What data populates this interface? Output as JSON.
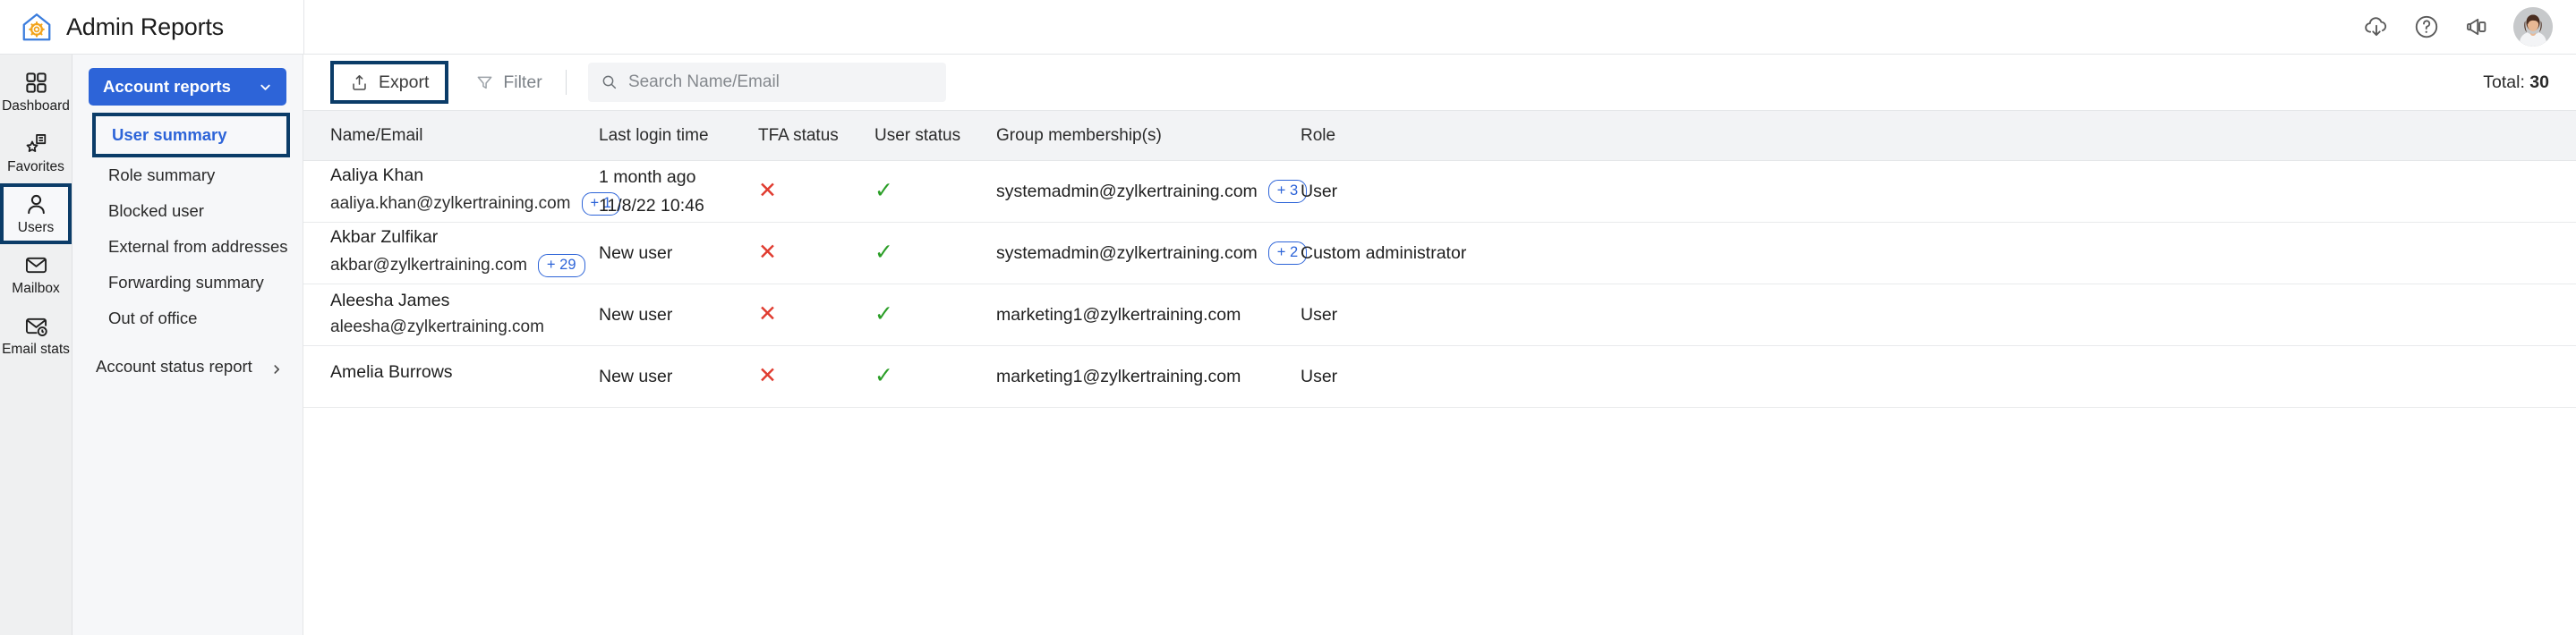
{
  "app": {
    "brand_title": "Admin Reports",
    "logo_icon": "house-gear-icon"
  },
  "topbar": {
    "actions": [
      {
        "icon": "cloud-download-icon",
        "name": "download-button"
      },
      {
        "icon": "help-circle-icon",
        "name": "help-button"
      },
      {
        "icon": "megaphone-icon",
        "name": "announcements-button"
      }
    ],
    "avatar": {
      "icon": "avatar",
      "name": "user-avatar"
    }
  },
  "rail": {
    "items": [
      {
        "label": "Dashboard",
        "icon": "grid-icon",
        "active": false
      },
      {
        "label": "Favorites",
        "icon": "star-list-icon",
        "active": false
      },
      {
        "label": "Users",
        "icon": "user-icon",
        "active": true
      },
      {
        "label": "Mailbox",
        "icon": "envelope-icon",
        "active": false
      },
      {
        "label": "Email stats",
        "icon": "envelope-clock-icon",
        "active": false
      }
    ]
  },
  "subnav": {
    "account_reports_label": "Account reports",
    "account_reports_chevron": "chevron-down-icon",
    "items": [
      {
        "label": "User summary",
        "selected": true
      },
      {
        "label": "Role summary",
        "selected": false
      },
      {
        "label": "Blocked user",
        "selected": false
      },
      {
        "label": "External from addresses",
        "selected": false
      },
      {
        "label": "Forwarding summary",
        "selected": false
      },
      {
        "label": "Out of office",
        "selected": false
      }
    ],
    "footer": {
      "label": "Account status report",
      "chevron": "chevron-right-icon"
    }
  },
  "page": {
    "title": "User summary",
    "star_icon": "star-outline-icon"
  },
  "toolbar": {
    "export_label": "Export",
    "export_icon": "export-upload-icon",
    "filter_label": "Filter",
    "filter_icon": "funnel-icon",
    "search_icon": "search-icon",
    "search_placeholder": "Search Name/Email",
    "search_value": "",
    "total_label": "Total:",
    "total_value": "30"
  },
  "table": {
    "columns": [
      "Name/Email",
      "Last login time",
      "TFA status",
      "User status",
      "Group membership(s)",
      "Role"
    ],
    "rows": [
      {
        "name": "Aaliya Khan",
        "email": "aaliya.khan@zylkertraining.com",
        "email_badge": "+ 1",
        "last_login_line1": "1 month ago",
        "last_login_line2": "11/8/22 10:46",
        "tfa_status": "✕",
        "tfa_state": "disabled",
        "user_status": "✓",
        "user_state": "active",
        "group": "systemadmin@zylkertraining.com",
        "group_badge": "+ 3",
        "role": "User"
      },
      {
        "name": "Akbar Zulfikar",
        "email": "akbar@zylkertraining.com",
        "email_badge": "+ 29",
        "last_login_line1": "New user",
        "last_login_line2": "",
        "tfa_status": "✕",
        "tfa_state": "disabled",
        "user_status": "✓",
        "user_state": "active",
        "group": "systemadmin@zylkertraining.com",
        "group_badge": "+ 2",
        "role": "Custom administrator"
      },
      {
        "name": "Aleesha James",
        "email": "aleesha@zylkertraining.com",
        "email_badge": "",
        "last_login_line1": "New user",
        "last_login_line2": "",
        "tfa_status": "✕",
        "tfa_state": "disabled",
        "user_status": "✓",
        "user_state": "active",
        "group": "marketing1@zylkertraining.com",
        "group_badge": "",
        "role": "User"
      },
      {
        "name": "Amelia Burrows",
        "email": "",
        "email_badge": "",
        "last_login_line1": "New user",
        "last_login_line2": "",
        "tfa_status": "✕",
        "tfa_state": "disabled",
        "user_status": "✓",
        "user_state": "active",
        "group": "marketing1@zylkertraining.com",
        "group_badge": "",
        "role": "User"
      }
    ]
  },
  "colors": {
    "accent_blue": "#2d64d8",
    "highlight_navy": "#0b3c68",
    "status_ok": "#2a9e26",
    "status_bad": "#e03b2f",
    "rail_bg": "#eff0f1",
    "subnav_bg": "#f6f7f9"
  }
}
